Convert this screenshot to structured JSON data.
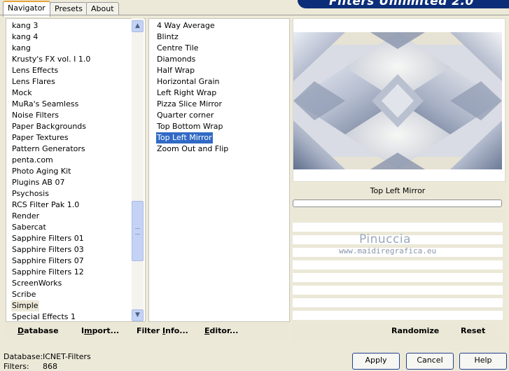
{
  "banner": {
    "title": "Filters Unlimited 2.0"
  },
  "tabs": [
    {
      "label": "Navigator"
    },
    {
      "label": "Presets"
    },
    {
      "label": "About"
    }
  ],
  "categories": [
    "kang 3",
    "kang 4",
    "kang",
    "Krusty's FX vol. I 1.0",
    "Lens Effects",
    "Lens Flares",
    "Mock",
    "MuRa's Seamless",
    "Noise Filters",
    "Paper Backgrounds",
    "Paper Textures",
    "Pattern Generators",
    "penta.com",
    "Photo Aging Kit",
    "Plugins AB 07",
    "Psychosis",
    "RCS Filter Pak 1.0",
    "Render",
    "Sabercat",
    "Sapphire Filters 01",
    "Sapphire Filters 03",
    "Sapphire Filters 07",
    "Sapphire Filters 12",
    "ScreenWorks",
    "Scribe",
    "Simple",
    "Special Effects 1"
  ],
  "selected_category": "Simple",
  "filters": [
    "4 Way Average",
    "Blintz",
    "Centre Tile",
    "Diamonds",
    "Half Wrap",
    "Horizontal Grain",
    "Left Right Wrap",
    "Pizza Slice Mirror",
    "Quarter corner",
    "Top Bottom Wrap",
    "Top Left Mirror",
    "Zoom Out and Flip"
  ],
  "selected_filter": "Top Left Mirror",
  "preview": {
    "filter_name": "Top Left Mirror"
  },
  "watermark": {
    "title": "Pinuccia",
    "url": "www.maidiregrafica.eu"
  },
  "left_bar": {
    "database": {
      "u": "D",
      "rest": "atabase"
    },
    "import": {
      "pre": "I",
      "u": "m",
      "rest": "port..."
    },
    "filter_info": {
      "pre": "Filter ",
      "u": "I",
      "rest": "nfo..."
    },
    "editor": {
      "u": "E",
      "rest": "ditor..."
    }
  },
  "right_bar": {
    "randomize": "Randomize",
    "reset": "Reset"
  },
  "status": {
    "database_label": "Database:",
    "database_value": "ICNET-Filters",
    "filters_label": "Filters:",
    "filters_value": "868"
  },
  "buttons": {
    "apply": "Apply",
    "cancel": "Cancel",
    "help": "Help"
  },
  "colors": {
    "selection": "#316ac5",
    "banner": "#0c2d78",
    "face": "#ece9d8"
  }
}
